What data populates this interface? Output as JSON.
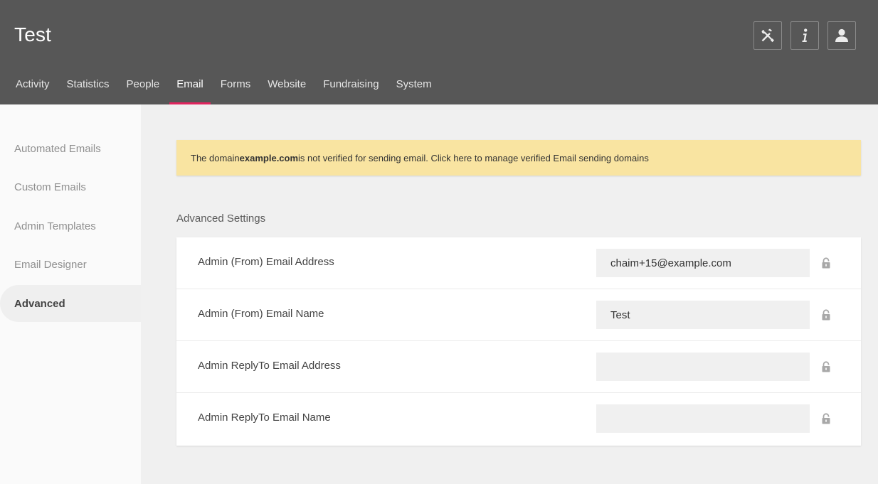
{
  "header": {
    "title": "Test",
    "buttons": [
      {
        "name": "tools",
        "icon": "tools-icon"
      },
      {
        "name": "info",
        "icon": "info-icon"
      },
      {
        "name": "user",
        "icon": "user-icon"
      }
    ]
  },
  "nav": {
    "tabs": [
      {
        "label": "Activity"
      },
      {
        "label": "Statistics"
      },
      {
        "label": "People"
      },
      {
        "label": "Email",
        "active": true
      },
      {
        "label": "Forms"
      },
      {
        "label": "Website"
      },
      {
        "label": "Fundraising"
      },
      {
        "label": "System"
      }
    ]
  },
  "sidebar": {
    "items": [
      {
        "label": "Automated Emails"
      },
      {
        "label": "Custom Emails"
      },
      {
        "label": "Admin Templates"
      },
      {
        "label": "Email Designer"
      },
      {
        "label": "Advanced",
        "active": true
      }
    ]
  },
  "alert": {
    "prefix": "The domain ",
    "domain": "example.com",
    "suffix": " is not verified for sending email. Click here to manage verified Email sending domains"
  },
  "settings": {
    "title": "Advanced Settings",
    "rows": [
      {
        "label": "Admin (From) Email Address",
        "value": "chaim+15@example.com"
      },
      {
        "label": "Admin (From) Email Name",
        "value": "Test"
      },
      {
        "label": "Admin ReplyTo Email Address",
        "value": ""
      },
      {
        "label": "Admin ReplyTo Email Name",
        "value": ""
      }
    ]
  },
  "colors": {
    "header_bg": "#575757",
    "accent": "#e0245e",
    "alert_bg": "#f9e4a1"
  }
}
